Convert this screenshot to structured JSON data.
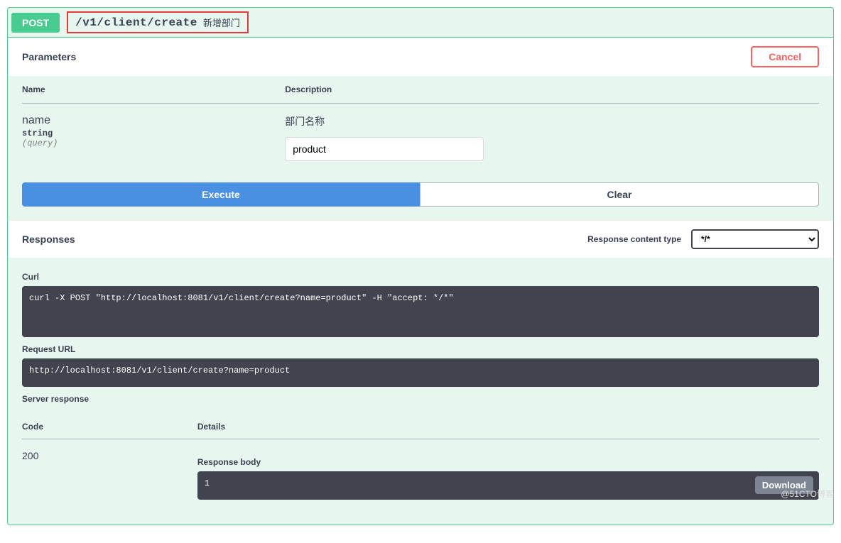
{
  "method": "POST",
  "path": "/v1/client/create",
  "summary": "新增部门",
  "parameters_heading": "Parameters",
  "cancel_label": "Cancel",
  "table_headers": {
    "name": "Name",
    "description": "Description"
  },
  "param": {
    "name": "name",
    "type": "string",
    "in": "(query)",
    "description": "部门名称",
    "value": "product"
  },
  "execute_label": "Execute",
  "clear_label": "Clear",
  "responses_heading": "Responses",
  "content_type_label": "Response content type",
  "content_type_value": "*/*",
  "curl_label": "Curl",
  "curl_cmd": "curl -X POST \"http://localhost:8081/v1/client/create?name=product\" -H \"accept: */*\"",
  "request_url_label": "Request URL",
  "request_url": "http://localhost:8081/v1/client/create?name=product",
  "server_response_label": "Server response",
  "resp_headers": {
    "code": "Code",
    "details": "Details"
  },
  "response": {
    "code": "200",
    "body_label": "Response body",
    "body": "1"
  },
  "download_label": "Download",
  "watermark": "@51CTO博客"
}
